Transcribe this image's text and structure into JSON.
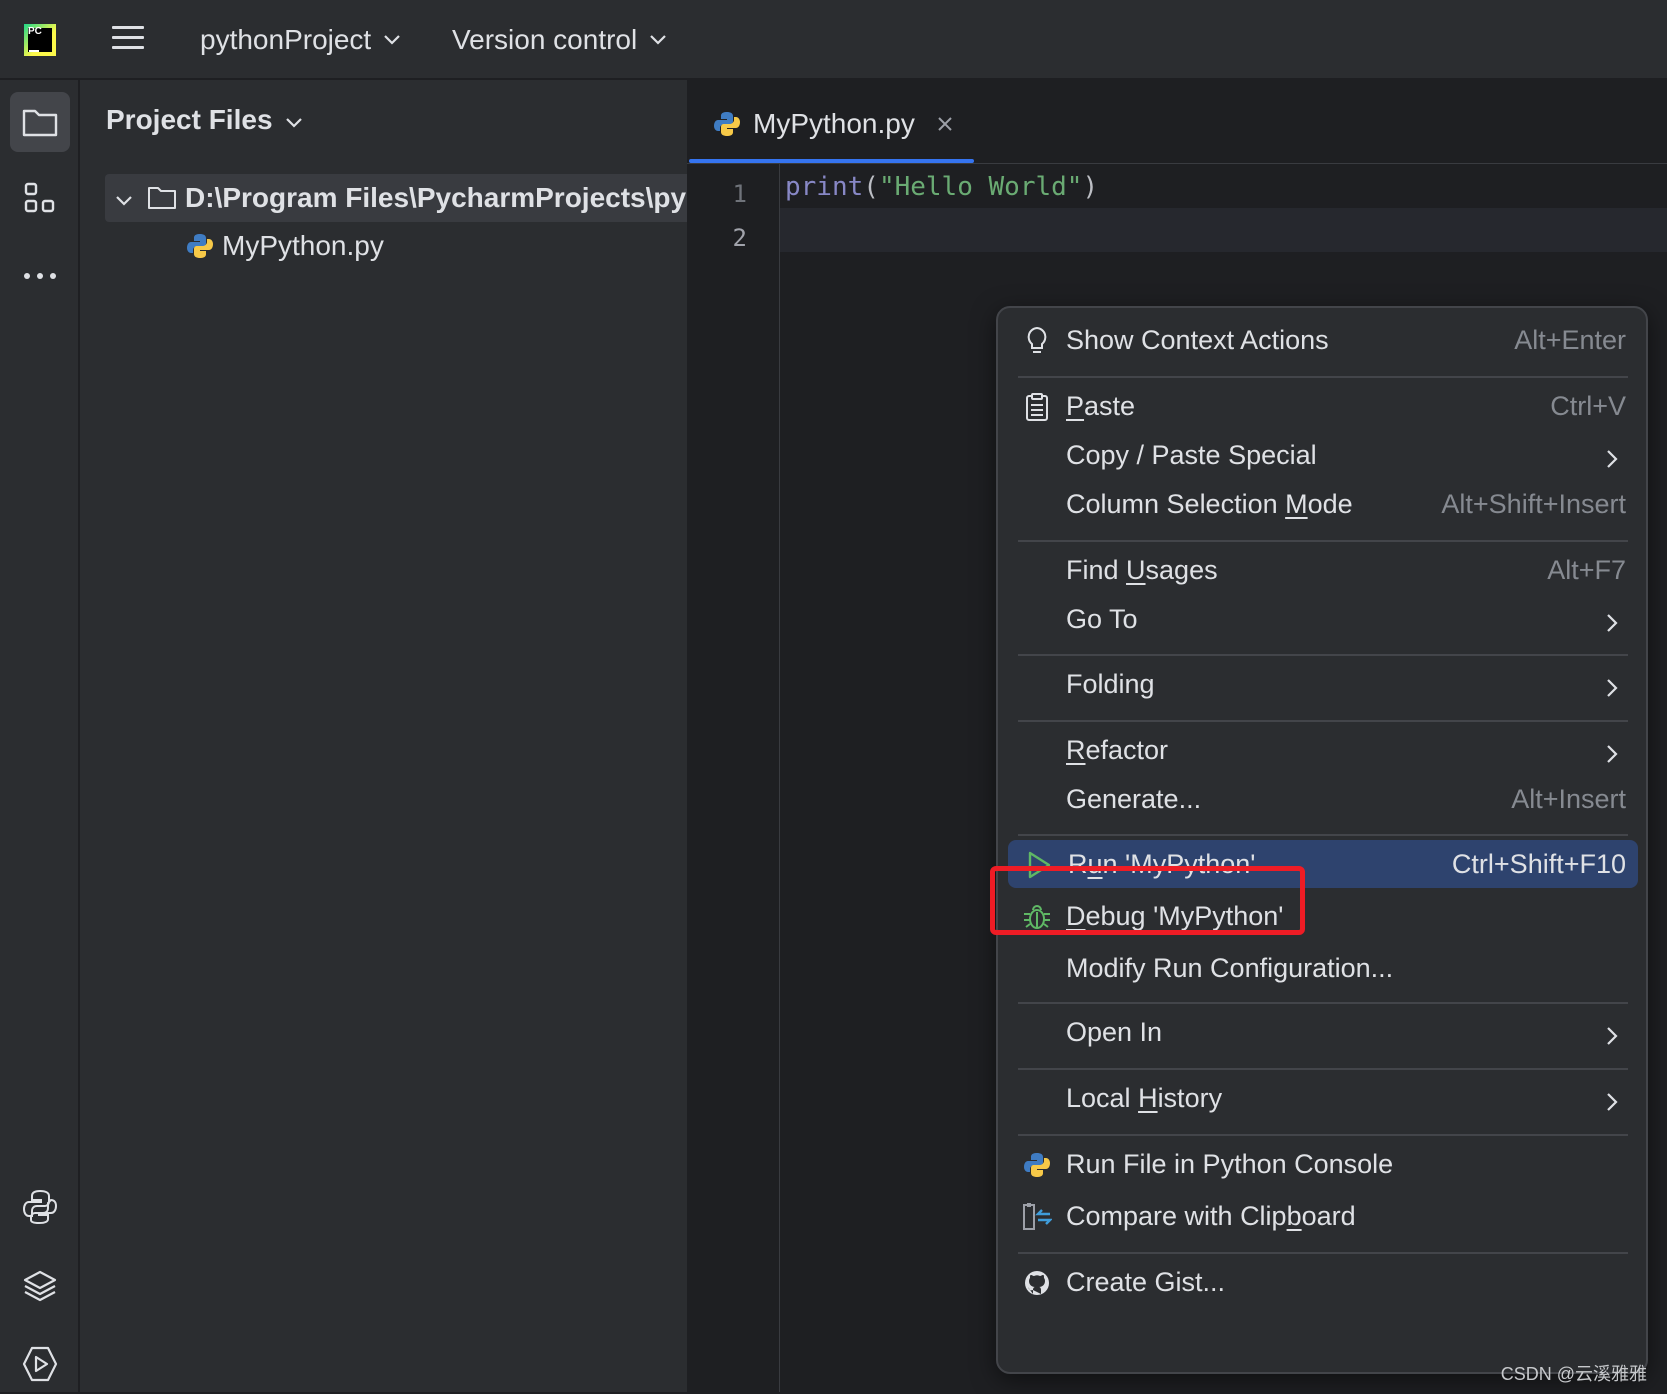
{
  "titlebar": {
    "logo_text": "PC",
    "project": "pythonProject",
    "version_control": "Version control"
  },
  "project_panel": {
    "title": "Project Files",
    "root_path": "D:\\Program Files\\PycharmProjects\\py",
    "file": "MyPython.py"
  },
  "editor": {
    "tab_label": "MyPython.py",
    "line_numbers": [
      "1",
      "2"
    ],
    "code": {
      "fn": "print",
      "open": "(",
      "string": "\"Hello World\"",
      "close": ")"
    }
  },
  "context_menu": {
    "items": [
      {
        "label": "Show Context Actions",
        "shortcut": "Alt+Enter",
        "icon": "lightbulb-icon"
      },
      {
        "label_pre": "",
        "label_u": "P",
        "label_post": "aste",
        "shortcut": "Ctrl+V",
        "icon": "clipboard-icon"
      },
      {
        "label": "Copy / Paste Special",
        "submenu": true
      },
      {
        "label_pre": "Column Selection ",
        "label_u": "M",
        "label_post": "ode",
        "shortcut": "Alt+Shift+Insert"
      },
      {
        "label_pre": "Find ",
        "label_u": "U",
        "label_post": "sages",
        "shortcut": "Alt+F7"
      },
      {
        "label": "Go To",
        "submenu": true
      },
      {
        "label": "Folding",
        "submenu": true
      },
      {
        "label_pre": "",
        "label_u": "R",
        "label_post": "efactor",
        "submenu": true
      },
      {
        "label": "Generate...",
        "shortcut": "Alt+Insert"
      },
      {
        "label_pre": "R",
        "label_u": "u",
        "label_post": "n 'MyPython'",
        "shortcut": "Ctrl+Shift+F10",
        "icon": "run-icon",
        "highlighted": true
      },
      {
        "label_pre": "",
        "label_u": "D",
        "label_post": "ebug 'MyPython'",
        "icon": "bug-icon"
      },
      {
        "label": "Modify Run Configuration..."
      },
      {
        "label": "Open In",
        "submenu": true
      },
      {
        "label_pre": "Local ",
        "label_u": "H",
        "label_post": "istory",
        "submenu": true
      },
      {
        "label": "Run File in Python Console",
        "icon": "python-icon"
      },
      {
        "label_pre": "Compare with Clip",
        "label_u": "b",
        "label_post": "oard",
        "icon": "compare-icon"
      },
      {
        "label": "Create Gist...",
        "icon": "github-icon"
      }
    ]
  },
  "watermark": "CSDN @云溪雅雅",
  "colors": {
    "background": "#1e1f22",
    "panel": "#2b2d30",
    "highlight": "#2e436e",
    "annotation_box": "#ee1c25",
    "string": "#6aab73",
    "keyword": "#8888c6"
  }
}
